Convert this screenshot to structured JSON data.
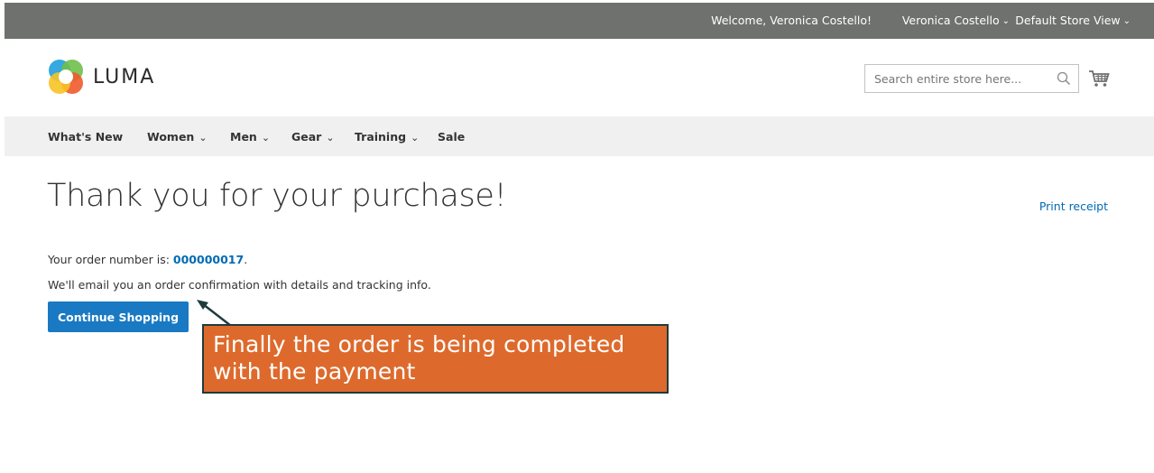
{
  "topbar": {
    "welcome": "Welcome, Veronica Costello!",
    "account_name": "Veronica Costello",
    "store_view": "Default Store View"
  },
  "header": {
    "logo_text": "LUMA",
    "search_placeholder": "Search entire store here...",
    "icons": [
      "search-icon",
      "cart-icon"
    ]
  },
  "nav": {
    "items": [
      {
        "label": "What's New",
        "has_dropdown": false
      },
      {
        "label": "Women",
        "has_dropdown": true
      },
      {
        "label": "Men",
        "has_dropdown": true
      },
      {
        "label": "Gear",
        "has_dropdown": true
      },
      {
        "label": "Training",
        "has_dropdown": true
      },
      {
        "label": "Sale",
        "has_dropdown": false
      }
    ]
  },
  "main": {
    "title": "Thank you for your purchase!",
    "print_receipt": "Print receipt",
    "order_prefix": "Your order number is: ",
    "order_number": "000000017",
    "order_suffix": ".",
    "email_note": "We'll email you an order confirmation with details and tracking info.",
    "continue_label": "Continue Shopping"
  },
  "callout": {
    "text": "Finally the order is being completed with the payment"
  },
  "colors": {
    "topbar_bg": "#6e716e",
    "link": "#006bb4",
    "primary_button": "#1979c3",
    "callout_bg": "#dd6a2c",
    "callout_border": "#1f3b3b",
    "nav_bg": "#f0f0f0"
  }
}
